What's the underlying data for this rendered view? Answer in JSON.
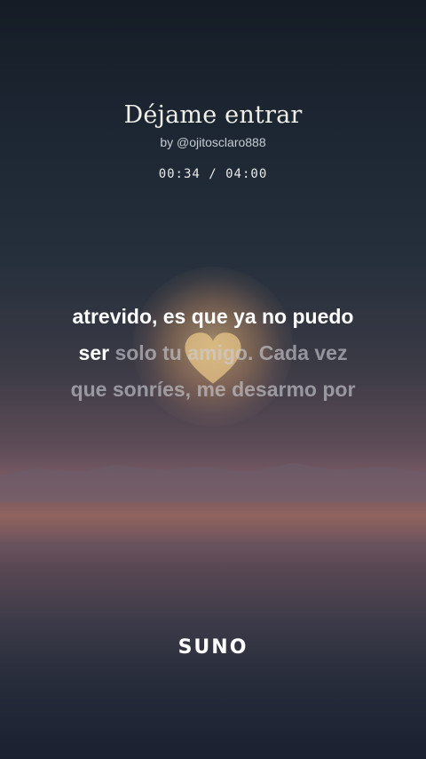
{
  "song": {
    "title": "Déjame entrar",
    "artist": "by @ojitosclaro888",
    "time": "00:34 / 04:00"
  },
  "lyrics": {
    "line1": "atrevido, es que ya no puedo",
    "line2_sung": "ser",
    "line2_unsung": " solo tu amigo. Cada vez",
    "line3": "que sonríes, me desarmo por"
  },
  "brand": {
    "logo": "SUNO"
  },
  "colors": {
    "sung_text": "#ffffff",
    "unsung_text": "#cdcdd4",
    "sun_glow": "#ffd28c"
  },
  "icons": {
    "background_art": "sunset-heart-icon"
  }
}
